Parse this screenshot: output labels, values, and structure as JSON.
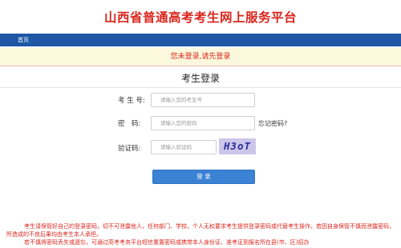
{
  "header": {
    "site_title": "山西省普通高考考生网上服务平台"
  },
  "nav": {
    "home_label": "首页"
  },
  "notice": {
    "text": "您未登录,请先登录"
  },
  "form": {
    "title": "考生登录",
    "candidate_number": {
      "label": "考 生 号:",
      "placeholder": "请输入您的考生号"
    },
    "password": {
      "label": "密　码:",
      "placeholder": "请输入您的密码",
      "forgot_label": "忘记密码?"
    },
    "captcha": {
      "label": "验证码:",
      "placeholder": "请输入验证码",
      "code": "H3oT"
    },
    "submit_label": "登 录"
  },
  "footer": {
    "note_line1": "考生请保管好自己的登录密码，切不可泄露他人，任何部门、学校、个人无权要求考生提供登录密码或代替考生操作。若因自身保管不慎而泄露密码，所造成的不良后果均由考生本人承担。",
    "note_line2": "若不慎将密码丢失或遗忘，可通过高考考务平台短信重置密码或携带本人身份证、准考证到报名所在县(市、区)招办"
  },
  "colors": {
    "title_red": "#d9261c",
    "nav_blue": "#1d57a6",
    "notice_bg": "#fcf8de",
    "button_blue": "#3b82d4",
    "captcha_bg": "#ccc6ea"
  }
}
